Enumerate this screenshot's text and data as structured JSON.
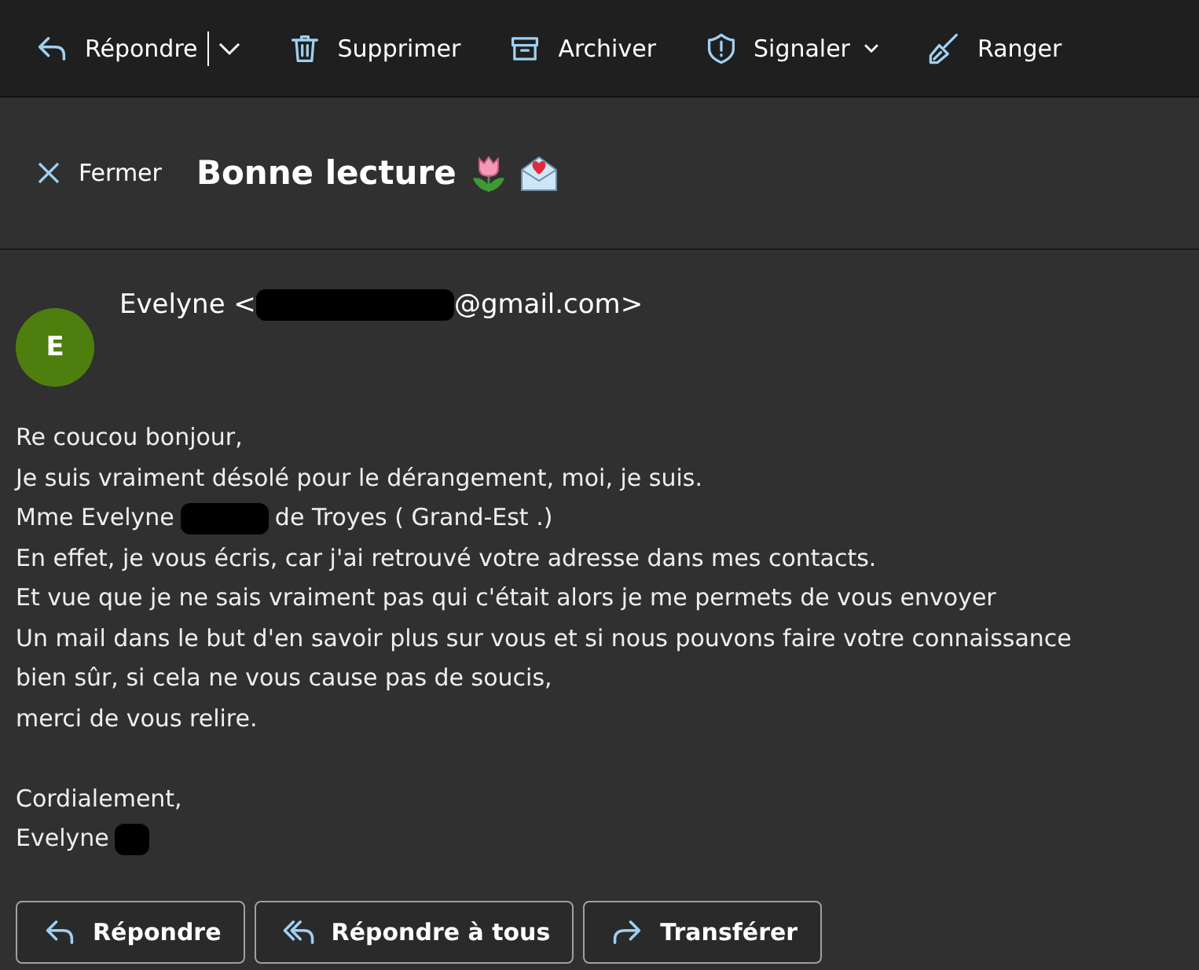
{
  "toolbar": [
    {
      "label": "Répondre"
    },
    {
      "label": "Supprimer"
    },
    {
      "label": "Archiver"
    },
    {
      "label": "Signaler"
    },
    {
      "label": "Ranger"
    }
  ],
  "header": {
    "close_label": "Fermer",
    "subject": "Bonne lecture"
  },
  "sender": {
    "initial": "E",
    "before": "Evelyne <",
    "after": "@gmail.com>"
  },
  "body": [
    {
      "kind": "plain",
      "parts": [
        "Re coucou bonjour,"
      ]
    },
    {
      "kind": "plain",
      "parts": [
        "Je suis vraiment désolé pour le dérangement, moi, je suis."
      ]
    },
    {
      "kind": "redacted",
      "parts": [
        "Mme Evelyne",
        "de Troyes ( Grand-Est .)"
      ]
    },
    {
      "kind": "plain",
      "parts": [
        "En effet, je vous écris, car j'ai retrouvé votre adresse dans mes contacts."
      ]
    },
    {
      "kind": "plain",
      "parts": [
        "Et vue que je ne sais vraiment pas qui c'était alors je me permets de vous envoyer"
      ]
    },
    {
      "kind": "plain",
      "parts": [
        "Un mail dans le but d'en savoir plus sur vous et si nous pouvons faire votre connaissance"
      ]
    },
    {
      "kind": "plain",
      "parts": [
        "bien sûr, si cela ne vous cause pas de soucis,"
      ]
    },
    {
      "kind": "plain",
      "parts": [
        "merci de vous relire."
      ]
    },
    {
      "kind": "blank"
    },
    {
      "kind": "plain",
      "parts": [
        "Cordialement,"
      ]
    },
    {
      "kind": "redacted",
      "parts": [
        "Evelyne"
      ]
    }
  ],
  "actions": [
    {
      "label": "Répondre"
    },
    {
      "label": "Répondre à tous"
    },
    {
      "label": "Transférer"
    }
  ]
}
